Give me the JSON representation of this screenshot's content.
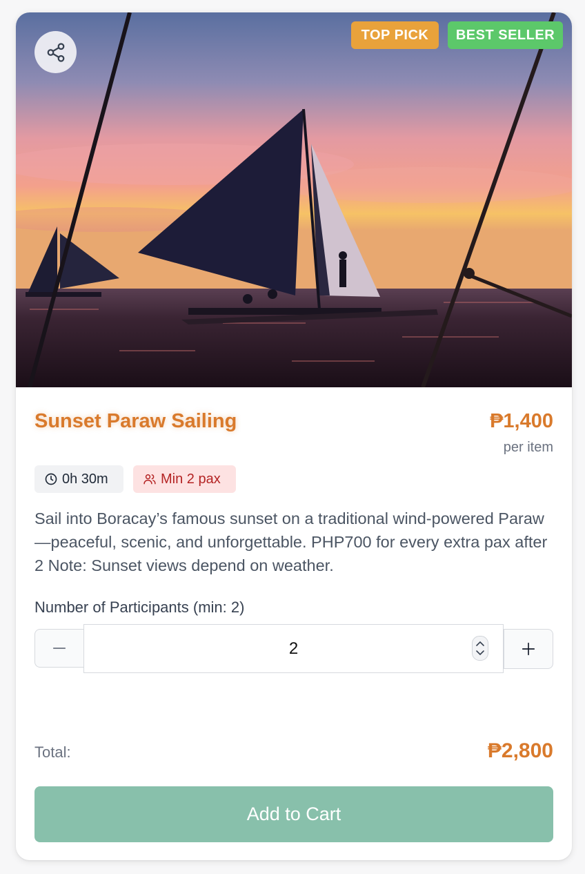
{
  "colors": {
    "accent": "#d97a2c",
    "top_pick_bg": "#e9a23b",
    "best_seller_bg": "#5cc86a",
    "cart_button_bg": "#88c0ab",
    "min_pax_text": "#b42323"
  },
  "product": {
    "title": "Sunset Paraw Sailing",
    "price": "₱1,400",
    "price_unit": "per item",
    "badges": {
      "top_pick": "TOP PICK",
      "best_seller": "BEST SELLER"
    },
    "duration": "0h 30m",
    "min_pax": "Min 2 pax",
    "description": "Sail into Boracay’s famous sunset on a traditional wind-powered Paraw—peaceful, scenic, and unforgettable. PHP700 for every extra pax after 2 Note: Sunset views depend on weather."
  },
  "participants": {
    "label": "Number of Participants (min: 2)",
    "value": "2"
  },
  "total": {
    "label": "Total:",
    "value": "₱2,800"
  },
  "actions": {
    "add_to_cart": "Add to Cart"
  },
  "icons": {
    "share": "share-icon",
    "clock": "clock-icon",
    "users": "users-icon",
    "minus": "minus-icon",
    "plus": "plus-icon"
  }
}
